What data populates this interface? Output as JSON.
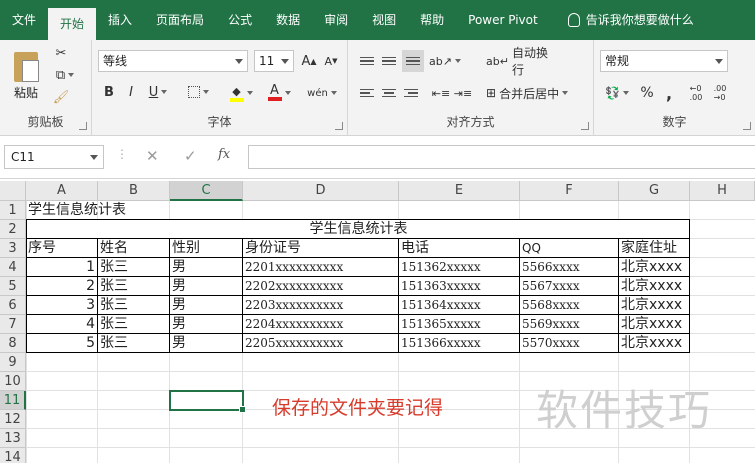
{
  "tabs": [
    "文件",
    "开始",
    "插入",
    "页面布局",
    "公式",
    "数据",
    "审阅",
    "视图",
    "帮助",
    "Power Pivot"
  ],
  "active_tab": "开始",
  "tell_me": "告诉我你想要做什么",
  "ribbon": {
    "clipboard": {
      "label": "剪贴板",
      "paste": "粘贴"
    },
    "font": {
      "label": "字体",
      "name": "等线",
      "size": "11",
      "bold": "B",
      "italic": "I",
      "underline": "U",
      "grow": "A",
      "shrink": "A",
      "phonetic": "wén"
    },
    "alignment": {
      "label": "对齐方式",
      "wrap": "自动换行",
      "merge": "合并后居中"
    },
    "number": {
      "label": "数字",
      "format": "常规",
      "percent": "%",
      "comma": ","
    }
  },
  "formula_bar": {
    "name_box": "C11",
    "cancel": "✕",
    "enter": "✓",
    "fx": "fx",
    "value": ""
  },
  "columns": [
    "A",
    "B",
    "C",
    "D",
    "E",
    "F",
    "G",
    "H"
  ],
  "rows": [
    "1",
    "2",
    "3",
    "4",
    "5",
    "6",
    "7",
    "8",
    "9",
    "10",
    "11",
    "12",
    "13",
    "14"
  ],
  "selected_cell": "C11",
  "sheet": {
    "a1": "学生信息统计表",
    "title": "学生信息统计表",
    "headers": [
      "序号",
      "姓名",
      "性别",
      "身份证号",
      "电话",
      "QQ",
      "家庭住址"
    ],
    "data": [
      [
        "1",
        "张三",
        "男",
        "2201xxxxxxxxxx",
        "151362xxxxx",
        "5566xxxx",
        "北京xxxx"
      ],
      [
        "2",
        "张三",
        "男",
        "2202xxxxxxxxxx",
        "151363xxxxx",
        "5567xxxx",
        "北京xxxx"
      ],
      [
        "3",
        "张三",
        "男",
        "2203xxxxxxxxxx",
        "151364xxxxx",
        "5568xxxx",
        "北京xxxx"
      ],
      [
        "4",
        "张三",
        "男",
        "2204xxxxxxxxxx",
        "151365xxxxx",
        "5569xxxx",
        "北京xxxx"
      ],
      [
        "5",
        "张三",
        "男",
        "2205xxxxxxxxxx",
        "151366xxxxx",
        "5570xxxx",
        "北京xxxx"
      ]
    ]
  },
  "annotation": "保存的文件夹要记得",
  "watermark": "软件技巧",
  "colors": {
    "accent": "#217346",
    "annotation": "#d83b2b",
    "font_color_bar": "#e02020",
    "fill_color_bar": "#ffff00"
  }
}
